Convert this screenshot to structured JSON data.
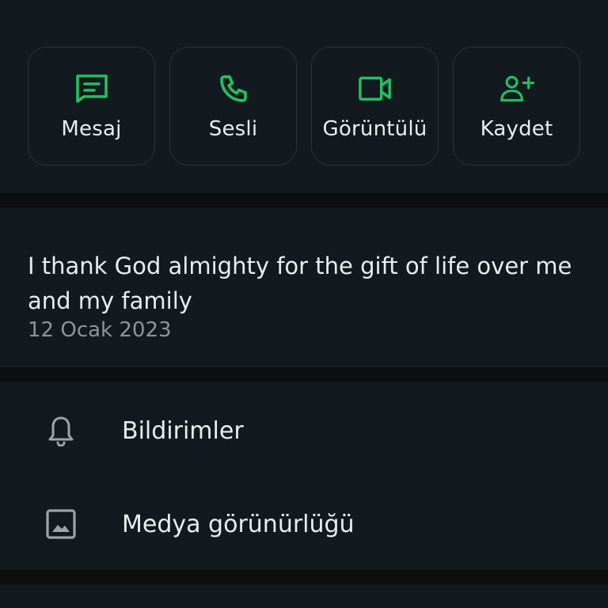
{
  "actions": [
    {
      "label": "Mesaj",
      "icon": "message-icon"
    },
    {
      "label": "Sesli",
      "icon": "phone-icon"
    },
    {
      "label": "Görüntülü",
      "icon": "video-icon"
    },
    {
      "label": "Kaydet",
      "icon": "add-contact-icon"
    }
  ],
  "about": {
    "text": "I thank God almighty for the gift of life over me and my family",
    "date": "12 Ocak 2023"
  },
  "list": {
    "notifications_label": "Bildirimler",
    "media_label": "Medya görünürlüğü"
  },
  "colors": {
    "accent": "#21c063",
    "background": "#0b0f10",
    "panel": "#121a1f",
    "text": "#e9edef",
    "muted": "#8b969c"
  }
}
